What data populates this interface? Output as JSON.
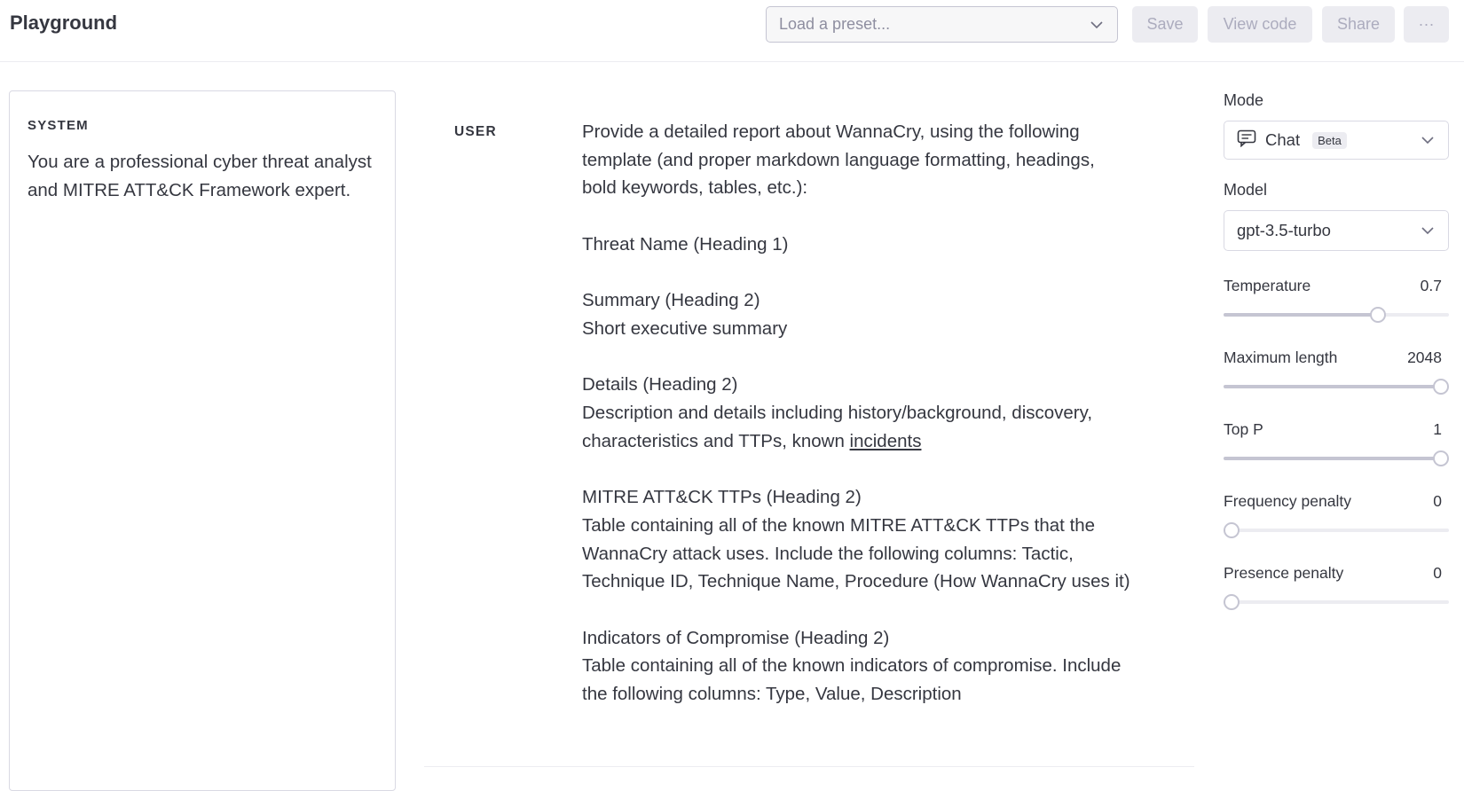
{
  "header": {
    "title": "Playground",
    "preset_placeholder": "Load a preset...",
    "buttons": {
      "save": "Save",
      "view_code": "View code",
      "share": "Share",
      "more": "···"
    }
  },
  "system": {
    "label": "SYSTEM",
    "text": "You are a professional cyber threat analyst and MITRE ATT&CK Framework expert."
  },
  "conversation": {
    "role_label": "USER",
    "message_before_link": "Provide a detailed report about WannaCry, using the following template (and proper markdown language formatting, headings, bold keywords, tables, etc.):\n\nThreat Name (Heading 1)\n\nSummary (Heading 2)\nShort executive summary\n\nDetails (Heading 2)\nDescription and details including history/background, discovery, characteristics and TTPs, known ",
    "message_link": "incidents",
    "message_after_link": "\n\nMITRE ATT&CK TTPs (Heading 2)\nTable containing all of the known MITRE ATT&CK TTPs that the WannaCry attack uses. Include the following columns: Tactic, Technique ID, Technique Name, Procedure (How WannaCry uses it)\n\nIndicators of Compromise (Heading 2)\nTable containing all of the known indicators of compromise. Include the following columns: Type, Value, Description"
  },
  "settings": {
    "mode": {
      "label": "Mode",
      "value": "Chat",
      "badge": "Beta",
      "icon": "chat-icon"
    },
    "model": {
      "label": "Model",
      "value": "gpt-3.5-turbo"
    },
    "params": [
      {
        "name": "Temperature",
        "display": "0.7",
        "fraction": 0.7
      },
      {
        "name": "Maximum length",
        "display": "2048",
        "fraction": 1.0
      },
      {
        "name": "Top P",
        "display": "1",
        "fraction": 1.0
      },
      {
        "name": "Frequency penalty",
        "display": "0",
        "fraction": 0.0
      },
      {
        "name": "Presence penalty",
        "display": "0",
        "fraction": 0.0
      }
    ]
  },
  "colors": {
    "text": "#353740",
    "muted": "#acacbe",
    "border": "#d9d9e3",
    "button_bg": "#ececf1",
    "slider_fill": "#c5c5d2"
  }
}
